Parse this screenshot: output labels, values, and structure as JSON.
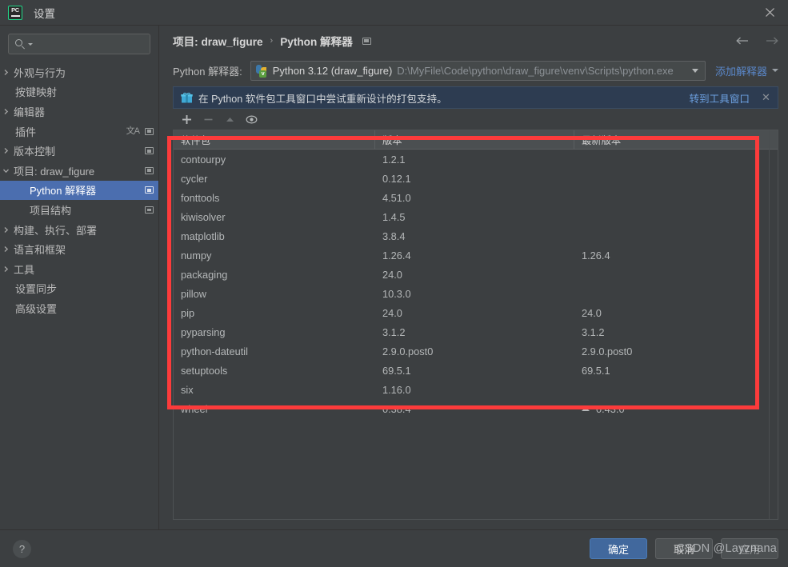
{
  "window": {
    "title": "设置",
    "logo_text": "PC",
    "close_icon": "close-icon"
  },
  "sidebar": {
    "search": {
      "value": "",
      "placeholder": ""
    },
    "items": [
      {
        "label": "外观与行为",
        "level": 0,
        "arrow": "right",
        "selected": false,
        "badges": []
      },
      {
        "label": "按键映射",
        "level": 0,
        "arrow": "none",
        "selected": false,
        "badges": []
      },
      {
        "label": "编辑器",
        "level": 0,
        "arrow": "right",
        "selected": false,
        "badges": []
      },
      {
        "label": "插件",
        "level": 0,
        "arrow": "none",
        "selected": false,
        "badges": [
          "lang",
          "square"
        ]
      },
      {
        "label": "版本控制",
        "level": 0,
        "arrow": "right",
        "selected": false,
        "badges": [
          "square"
        ]
      },
      {
        "label": "项目: draw_figure",
        "level": 0,
        "arrow": "down",
        "selected": false,
        "badges": [
          "square"
        ]
      },
      {
        "label": "Python 解释器",
        "level": 1,
        "arrow": "none",
        "selected": true,
        "badges": [
          "square"
        ]
      },
      {
        "label": "项目结构",
        "level": 1,
        "arrow": "none",
        "selected": false,
        "badges": [
          "square"
        ]
      },
      {
        "label": "构建、执行、部署",
        "level": 0,
        "arrow": "right",
        "selected": false,
        "badges": []
      },
      {
        "label": "语言和框架",
        "level": 0,
        "arrow": "right",
        "selected": false,
        "badges": []
      },
      {
        "label": "工具",
        "level": 0,
        "arrow": "right",
        "selected": false,
        "badges": []
      },
      {
        "label": "设置同步",
        "level": 0,
        "arrow": "none",
        "selected": false,
        "badges": []
      },
      {
        "label": "高级设置",
        "level": 0,
        "arrow": "none",
        "selected": false,
        "badges": []
      }
    ]
  },
  "main": {
    "breadcrumb": {
      "project": "项目: draw_figure",
      "separator": "›",
      "page": "Python 解释器"
    },
    "nav": {
      "back_icon": "arrow-left-icon",
      "forward_icon": "arrow-right-icon"
    },
    "interpreter": {
      "label": "Python 解释器:",
      "name": "Python 3.12 (draw_figure)",
      "path": "D:\\MyFile\\Code\\python\\draw_figure\\venv\\Scripts\\python.exe",
      "add_link": "添加解释器"
    },
    "promo": {
      "text": "在 Python 软件包工具窗口中尝试重新设计的打包支持。",
      "link": "转到工具窗口",
      "close": "✕"
    },
    "toolbar": {
      "add": "+",
      "remove": "−",
      "upgrade": "▲",
      "eye": "◉"
    },
    "table": {
      "columns": [
        "软件包",
        "版本",
        "最新版本"
      ],
      "rows": [
        {
          "package": "contourpy",
          "version": "1.2.1",
          "latest": "",
          "upgradable": false
        },
        {
          "package": "cycler",
          "version": "0.12.1",
          "latest": "",
          "upgradable": false
        },
        {
          "package": "fonttools",
          "version": "4.51.0",
          "latest": "",
          "upgradable": false
        },
        {
          "package": "kiwisolver",
          "version": "1.4.5",
          "latest": "",
          "upgradable": false
        },
        {
          "package": "matplotlib",
          "version": "3.8.4",
          "latest": "",
          "upgradable": false
        },
        {
          "package": "numpy",
          "version": "1.26.4",
          "latest": "1.26.4",
          "upgradable": false
        },
        {
          "package": "packaging",
          "version": "24.0",
          "latest": "",
          "upgradable": false
        },
        {
          "package": "pillow",
          "version": "10.3.0",
          "latest": "",
          "upgradable": false
        },
        {
          "package": "pip",
          "version": "24.0",
          "latest": "24.0",
          "upgradable": false
        },
        {
          "package": "pyparsing",
          "version": "3.1.2",
          "latest": "3.1.2",
          "upgradable": false
        },
        {
          "package": "python-dateutil",
          "version": "2.9.0.post0",
          "latest": "2.9.0.post0",
          "upgradable": false
        },
        {
          "package": "setuptools",
          "version": "69.5.1",
          "latest": "69.5.1",
          "upgradable": false
        },
        {
          "package": "six",
          "version": "1.16.0",
          "latest": "",
          "upgradable": false
        },
        {
          "package": "wheel",
          "version": "0.38.4",
          "latest": "0.43.0",
          "upgradable": true
        }
      ]
    }
  },
  "footer": {
    "help": "?",
    "ok": "确定",
    "cancel": "取消",
    "apply": "应用"
  },
  "overlay": {
    "watermark": "CSDN @Layznana",
    "highlight_color": "#fc3b3b"
  }
}
